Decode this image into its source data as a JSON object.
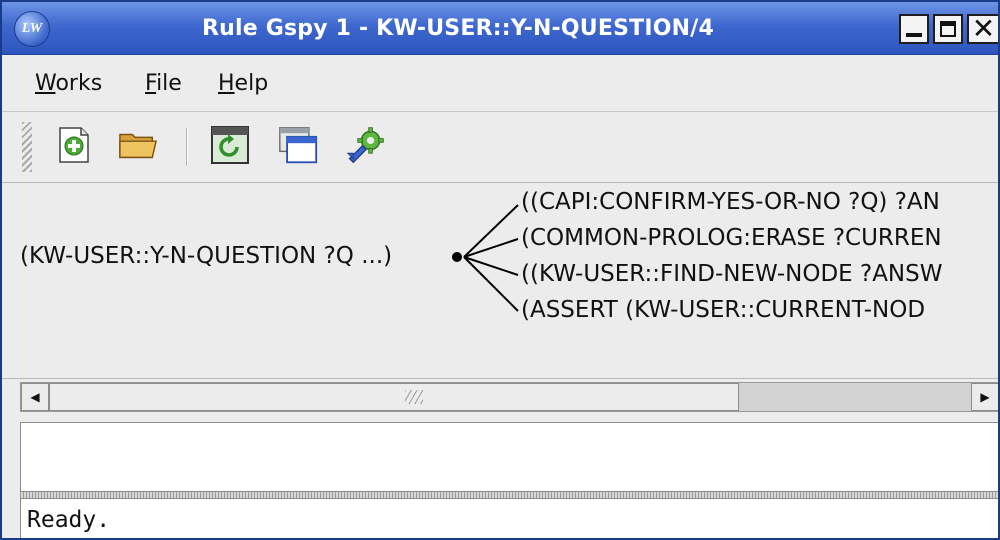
{
  "window": {
    "title": "Rule Gspy 1 - KW-USER::Y-N-QUESTION/4",
    "app_icon_text": "LW",
    "controls": {
      "minimize": "minimize",
      "maximize": "maximize",
      "close": "✕"
    }
  },
  "menubar": {
    "items": [
      {
        "label_first": "W",
        "label_rest": "orks"
      },
      {
        "label_first": "F",
        "label_rest": "ile"
      },
      {
        "label_first": "H",
        "label_rest": "elp"
      }
    ]
  },
  "toolbar": {
    "buttons": [
      {
        "icon": "new-document-icon"
      },
      {
        "icon": "open-folder-icon"
      },
      {
        "icon": "refresh-window-icon"
      },
      {
        "icon": "window-icon"
      },
      {
        "icon": "tools-gear-icon"
      }
    ]
  },
  "graph": {
    "root": "(KW-USER::Y-N-QUESTION ?Q ...)",
    "leaves": [
      "((CAPI:CONFIRM-YES-OR-NO ?Q) ?AN",
      "(COMMON-PROLOG:ERASE ?CURREN",
      "((KW-USER::FIND-NEW-NODE ?ANSW",
      "(ASSERT (KW-USER::CURRENT-NOD"
    ]
  },
  "scrollbar": {
    "left_arrow": "◀",
    "right_arrow": "▶"
  },
  "status": {
    "text": "Ready."
  },
  "colors": {
    "titlebar": "#3f68cf",
    "background": "#ececec",
    "panel": "#ffffff"
  }
}
